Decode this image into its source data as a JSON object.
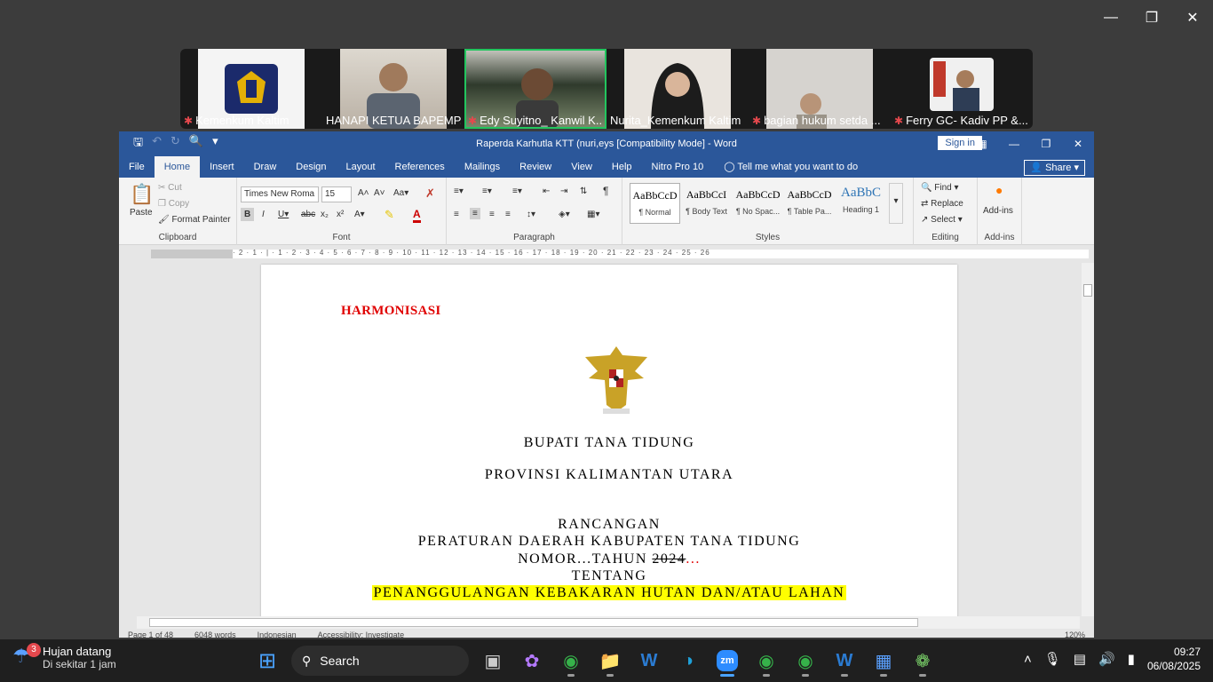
{
  "participants": [
    {
      "name": "Kemenkum Kaltim",
      "muted": true,
      "active": false
    },
    {
      "name": "HANAPI KETUA BAPEMP...",
      "muted": false,
      "active": false
    },
    {
      "name": "Edy Suyitno_ Kanwil K...",
      "muted": true,
      "active": true
    },
    {
      "name": "Nurita_Kemenkum Kaltim",
      "muted": false,
      "active": false
    },
    {
      "name": "bagian hukum setda ...",
      "muted": true,
      "active": false
    },
    {
      "name": "Ferry GC- Kadiv PP &...",
      "muted": true,
      "active": false
    }
  ],
  "word": {
    "title": "Raperda Karhutla KTT (nuri,eys [Compatibility Mode] - Word",
    "sign_in": "Sign in",
    "tabs": [
      "File",
      "Home",
      "Insert",
      "Draw",
      "Design",
      "Layout",
      "References",
      "Mailings",
      "Review",
      "View",
      "Help",
      "Nitro Pro 10"
    ],
    "tell_me": "Tell me what you want to do",
    "share": "Share",
    "clipboard": {
      "paste": "Paste",
      "cut": "Cut",
      "copy": "Copy",
      "format_painter": "Format Painter",
      "label": "Clipboard"
    },
    "font": {
      "name": "Times New Roma",
      "size": "15",
      "label": "Font"
    },
    "paragraph": {
      "label": "Paragraph"
    },
    "styles": {
      "label": "Styles",
      "items": [
        {
          "sample": "AaBbCcD",
          "name": "¶ Normal"
        },
        {
          "sample": "AaBbCcI",
          "name": "¶ Body Text"
        },
        {
          "sample": "AaBbCcD",
          "name": "¶ No Spac..."
        },
        {
          "sample": "AaBbCcD",
          "name": "¶ Table Pa..."
        },
        {
          "sample": "AaBbC",
          "name": "Heading 1"
        }
      ]
    },
    "editing": {
      "find": "Find",
      "replace": "Replace",
      "select": "Select",
      "label": "Editing"
    },
    "addins": {
      "button": "Add-ins",
      "label": "Add-ins"
    },
    "ruler": "· 2 · 1 · | · 1 · 2 · 3 · 4 · 5 · 6 · 7 · 8 · 9 · 10 · 11 · 12 · 13 · 14 · 15 · 16 · 17 · 18 · 19 · 20 · 21 · 22 · 23 · 24 · 25 · 26",
    "document": {
      "heading": "HARMONISASI",
      "line1": "BUPATI TANA TIDUNG",
      "line2": "PROVINSI KALIMANTAN UTARA",
      "line3": "RANCANGAN",
      "line4": "PERATURAN DAERAH KABUPATEN TANA TIDUNG",
      "line5_pre": "NOMOR...TAHUN ",
      "line5_strike": "2024",
      "line5_post": "...",
      "line6": "TENTANG",
      "line7": "PENANGGULANGAN KEBAKARAN HUTAN DAN/ATAU LAHAN"
    },
    "status": {
      "page": "Page 1 of 48",
      "words": "6048 words",
      "language": "Indonesian",
      "accessibility": "Accessibility: Investigate",
      "zoom": "120%"
    }
  },
  "taskbar": {
    "weather_title": "Hujan datang",
    "weather_sub": "Di sekitar 1 jam",
    "notification_count": "3",
    "search": "Search",
    "time": "09:27",
    "date": "06/08/2025"
  }
}
